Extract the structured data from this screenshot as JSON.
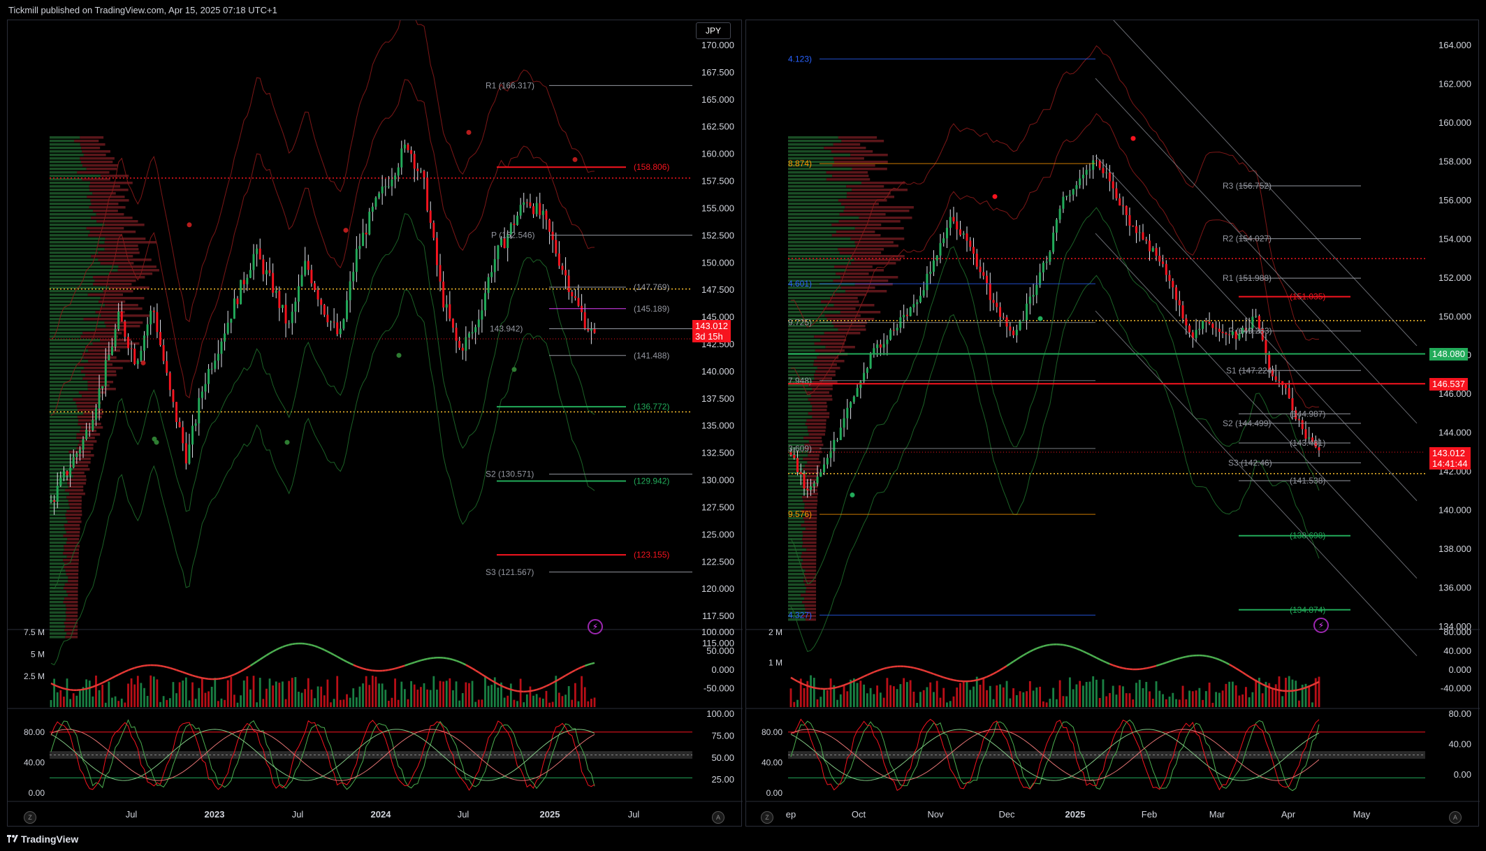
{
  "header": {
    "published": "Tickmill published on TradingView.com, Apr 15, 2025 07:18 UTC+1"
  },
  "footer": {
    "brand": "TradingView"
  },
  "colors": {
    "up": "#22ab5a",
    "down": "#f7141f",
    "background": "#000000",
    "grid": "#1a1a1a"
  },
  "left": {
    "symbol_badge": "JPY",
    "price_axis": [
      "170.000",
      "167.500",
      "165.000",
      "162.500",
      "160.000",
      "157.500",
      "155.000",
      "152.500",
      "150.000",
      "147.500",
      "145.000",
      "142.500",
      "140.000",
      "137.500",
      "135.000",
      "132.500",
      "130.000",
      "127.500",
      "125.000",
      "122.500",
      "120.000",
      "117.500",
      "115.000"
    ],
    "time_axis": [
      "Jul",
      "2023",
      "Jul",
      "2024",
      "Jul",
      "2025",
      "Jul"
    ],
    "vol_axis_left": [
      "7.5 M",
      "5 M",
      "2.5 M"
    ],
    "vol_axis_right": [
      "100.000",
      "50.000",
      "0.000",
      "-50.000"
    ],
    "osc_axis_left": [
      "80.00",
      "40.00",
      "0.00"
    ],
    "osc_axis_right": [
      "100.00",
      "75.00",
      "50.00",
      "25.00"
    ],
    "price_tag": {
      "price": "143.012",
      "countdown": "3d 15h"
    },
    "levels": [
      {
        "label": "R1 (166.317)",
        "color": "#9598a1"
      },
      {
        "label": "(158.806)",
        "color": "#f7141f"
      },
      {
        "label": "P (152.546)",
        "color": "#9598a1"
      },
      {
        "label": "(147.769)",
        "color": "#9598a1"
      },
      {
        "label": "(145.189)",
        "color": "#9598a1"
      },
      {
        "label": "143.942)",
        "color": "#9598a1"
      },
      {
        "label": "(141.488)",
        "color": "#9598a1"
      },
      {
        "label": "(136.772)",
        "color": "#22ab5a"
      },
      {
        "label": "S2 (130.571)",
        "color": "#9598a1"
      },
      {
        "label": "(129.942)",
        "color": "#22ab5a"
      },
      {
        "label": "(123.155)",
        "color": "#f7141f"
      },
      {
        "label": "S3 (121.567)",
        "color": "#9598a1"
      }
    ],
    "bottom_left_icon": "Z",
    "bottom_right_icon": "A"
  },
  "right": {
    "price_axis": [
      "164.000",
      "162.000",
      "160.000",
      "158.000",
      "156.000",
      "154.000",
      "152.000",
      "150.000",
      "148.000",
      "146.000",
      "144.000",
      "142.000",
      "140.000",
      "138.000",
      "136.000",
      "134.000"
    ],
    "time_axis": [
      "ep",
      "Oct",
      "Nov",
      "Dec",
      "2025",
      "Feb",
      "Mar",
      "Apr",
      "May"
    ],
    "vol_axis_left": [
      "2 M",
      "1 M"
    ],
    "vol_axis_right": [
      "80.000",
      "40.000",
      "0.000",
      "-40.000"
    ],
    "osc_axis_left": [
      "80.00",
      "40.00",
      "0.00"
    ],
    "osc_axis_right": [
      "80.00",
      "40.00",
      "0.00"
    ],
    "price_tag": {
      "price": "143.012",
      "countdown": "14:41:44"
    },
    "green_tag": "148.080",
    "red_tag": "146.537",
    "fib_labels": [
      "4.123)",
      "8.874)",
      "4.601)",
      "9.725)",
      "7.948)",
      "3.609)",
      "9.576)",
      "4.327)"
    ],
    "levels": [
      {
        "label": "R3 (156.752)",
        "color": "#9598a1"
      },
      {
        "label": "R2 (154.027)",
        "color": "#9598a1"
      },
      {
        "label": "R1 (151.988)",
        "color": "#9598a1"
      },
      {
        "label": "(151.035)",
        "color": "#f7141f"
      },
      {
        "label": "P (149.263)",
        "color": "#9598a1"
      },
      {
        "label": "S1 (147.224)",
        "color": "#9598a1"
      },
      {
        "label": "(144.987)",
        "color": "#9598a1"
      },
      {
        "label": "S2 (144.499)",
        "color": "#9598a1"
      },
      {
        "label": "(143.481)",
        "color": "#9598a1"
      },
      {
        "label": "S3 (142.46)",
        "color": "#9598a1"
      },
      {
        "label": "(141.538)",
        "color": "#9598a1"
      },
      {
        "label": "(138.698)",
        "color": "#22ab5a"
      },
      {
        "label": "(134.874)",
        "color": "#22ab5a"
      }
    ],
    "bottom_left_icon": "Z",
    "bottom_right_icon": "A"
  },
  "chart_data": [
    {
      "type": "candlestick",
      "title": "",
      "ylim": [
        115,
        170
      ],
      "x_ticks": [
        "Jul",
        "2023",
        "Jul",
        "2024",
        "Jul",
        "2025",
        "Jul"
      ],
      "approx_close_path": [
        128,
        131,
        134,
        139,
        145,
        141,
        146,
        138,
        132,
        139,
        143,
        147,
        151,
        148,
        144,
        150,
        146,
        143,
        151,
        155,
        158,
        161,
        157,
        147,
        142,
        144,
        150,
        153,
        156,
        154,
        150,
        146,
        143
      ],
      "last": 143.012
    },
    {
      "type": "candlestick",
      "title": "",
      "ylim": [
        134,
        164
      ],
      "x_ticks": [
        "ep",
        "Oct",
        "Nov",
        "Dec",
        "2025",
        "Feb",
        "Mar",
        "Apr",
        "May"
      ],
      "approx_close_path": [
        143,
        141,
        142,
        144,
        146,
        148,
        149,
        150,
        151,
        153,
        155,
        154,
        152,
        150,
        149,
        151,
        153,
        156,
        157,
        158,
        157,
        155,
        154,
        153,
        151,
        149,
        150,
        149,
        149,
        150,
        147,
        146,
        144,
        143
      ],
      "last": 143.012
    }
  ]
}
